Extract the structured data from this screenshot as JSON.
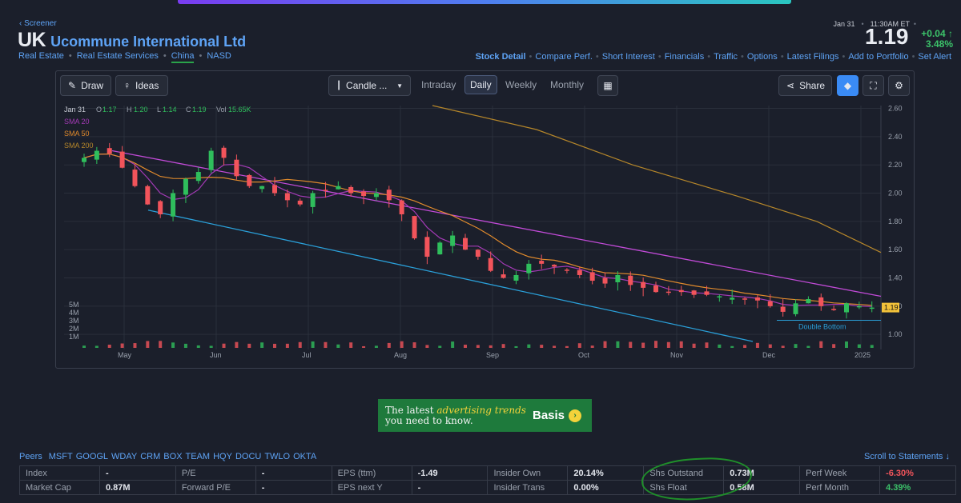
{
  "nav": {
    "back_label": "Screener"
  },
  "header": {
    "ticker": "UK",
    "company": "Ucommune International Ltd",
    "crumbs": [
      "Real Estate",
      "Real Estate Services",
      "China",
      "NASD"
    ],
    "date": "Jan 31",
    "time": "11:30AM ET",
    "price": "1.19",
    "change": "+0.04",
    "change_pct": "3.48%"
  },
  "links": [
    "Stock Detail",
    "Compare Perf.",
    "Short Interest",
    "Financials",
    "Traffic",
    "Options",
    "Latest Filings",
    "Add to Portfolio",
    "Set Alert"
  ],
  "toolbar": {
    "draw": "Draw",
    "ideas": "Ideas",
    "chart_type": "Candle ...",
    "tabs": [
      "Intraday",
      "Daily",
      "Weekly",
      "Monthly"
    ],
    "active_tab": "Daily",
    "share": "Share"
  },
  "chart_data": {
    "type": "candlestick",
    "legend": {
      "date": "Jan 31",
      "o": "1.17",
      "h": "1.20",
      "l": "1.14",
      "c": "1.19",
      "vol": "15.65K"
    },
    "indicators": [
      {
        "name": "SMA 20",
        "color": "#a33ab5"
      },
      {
        "name": "SMA 50",
        "color": "#e08a2c"
      },
      {
        "name": "SMA 200",
        "color": "#b5862a"
      }
    ],
    "x_ticks": [
      "May",
      "Jun",
      "Jul",
      "Aug",
      "Sep",
      "Oct",
      "Nov",
      "Dec",
      "2025"
    ],
    "y_ticks": [
      "2.60",
      "2.40",
      "2.20",
      "2.00",
      "1.80",
      "1.60",
      "1.40",
      "1.20",
      "1.00"
    ],
    "vol_ticks": [
      "5M",
      "4M",
      "3M",
      "2M",
      "1M"
    ],
    "ylim": [
      0.95,
      2.62
    ],
    "last_price": "1.19",
    "annotation": "Double Bottom",
    "closes": [
      2.25,
      2.3,
      2.28,
      2.18,
      2.05,
      1.92,
      1.85,
      2.0,
      2.1,
      2.15,
      2.3,
      2.25,
      2.12,
      2.05,
      2.05,
      2.0,
      1.95,
      1.92,
      2.0,
      2.02,
      2.05,
      2.0,
      1.98,
      2.0,
      1.95,
      1.85,
      1.68,
      1.55,
      1.65,
      1.7,
      1.6,
      1.55,
      1.45,
      1.4,
      1.42,
      1.5,
      1.5,
      1.48,
      1.45,
      1.42,
      1.38,
      1.36,
      1.42,
      1.35,
      1.33,
      1.3,
      1.3,
      1.3,
      1.28,
      1.28,
      1.27,
      1.26,
      1.25,
      1.24,
      1.2,
      1.16,
      1.22,
      1.25,
      1.2,
      1.18,
      1.22,
      1.2,
      1.19
    ]
  },
  "ad": {
    "line1": "The latest",
    "highlight": "advertising trends",
    "line2": "you need to know.",
    "brand": "Basis"
  },
  "peers": {
    "label": "Peers",
    "items": [
      "MSFT",
      "GOOGL",
      "WDAY",
      "CRM",
      "BOX",
      "TEAM",
      "HQY",
      "DOCU",
      "TWLO",
      "OKTA"
    ]
  },
  "scroll_label": "Scroll to Statements ↓",
  "stats": [
    [
      [
        "Index",
        "-"
      ],
      [
        "P/E",
        "-"
      ],
      [
        "EPS (ttm)",
        "-1.49"
      ],
      [
        "Insider Own",
        "20.14%"
      ],
      [
        "Shs Outstand",
        "0.73M"
      ],
      [
        "Perf Week",
        "-6.30%"
      ]
    ],
    [
      [
        "Market Cap",
        "0.87M"
      ],
      [
        "Forward P/E",
        "-"
      ],
      [
        "EPS next Y",
        "-"
      ],
      [
        "Insider Trans",
        "0.00%"
      ],
      [
        "Shs Float",
        "0.58M"
      ],
      [
        "Perf Month",
        "4.39%"
      ]
    ]
  ]
}
